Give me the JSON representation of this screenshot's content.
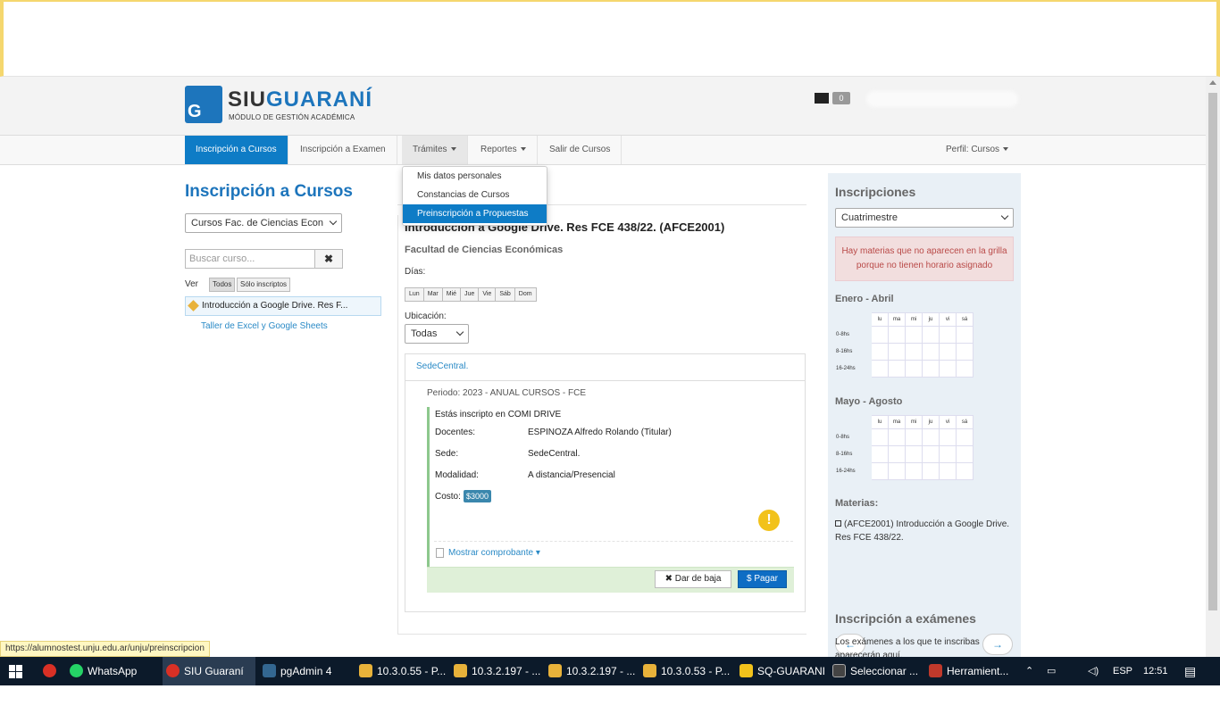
{
  "header": {
    "logo_main_a": "SIU",
    "logo_main_b": "GUARANÍ",
    "logo_sub": "MÓDULO DE GESTIÓN ACADÉMICA",
    "mail_count": "0"
  },
  "nav": {
    "items": [
      "Inscripción a Cursos",
      "Inscripción a Examen",
      "Trámites",
      "Reportes",
      "Salir de Cursos"
    ],
    "perfil": "Perfil: Cursos"
  },
  "dropdown": {
    "items": [
      "Mis datos personales",
      "Constancias de Cursos",
      "Preinscripción a Propuestas"
    ]
  },
  "left": {
    "title": "Inscripción a Cursos",
    "filter_select": "Cursos Fac. de Ciencias Econ",
    "search_placeholder": "Buscar curso...",
    "ver_label": "Ver",
    "btn_todos": "Todos",
    "btn_solo": "Sólo inscriptos",
    "courses": [
      "Introducción a Google Drive. Res F...",
      "Taller de Excel y Google Sheets"
    ]
  },
  "course": {
    "title": "Introducción a Google Drive. Res FCE 438/22. (AFCE2001)",
    "faculty": "Facultad de Ciencias Económicas",
    "dias_label": "Días:",
    "days": [
      "Lun",
      "Mar",
      "Mié",
      "Jue",
      "Vie",
      "Sáb",
      "Dom"
    ],
    "ubicacion_label": "Ubicación:",
    "ubicacion_value": "Todas",
    "sede_link": "SedeCentral.",
    "periodo": "Periodo: 2023 - ANUAL CURSOS - FCE",
    "inscripto": "Estás inscripto en COMI DRIVE",
    "docentes_label": "Docentes:",
    "docentes_value": "ESPINOZA Alfredo Rolando (Titular)",
    "sede_label": "Sede:",
    "sede_value": "SedeCentral.",
    "modalidad_label": "Modalidad:",
    "modalidad_value": "A distancia/Presencial",
    "costo_label": "Costo:",
    "costo_value": "$3000",
    "mostrar": "Mostrar comprobante ▾",
    "btn_baja": "✖ Dar de baja",
    "btn_pagar": "$ Pagar"
  },
  "side": {
    "title": "Inscripciones",
    "select": "Cuatrimestre",
    "alert": "Hay materias que no aparecen en la grilla porque no tienen horario asignado",
    "period1": "Enero - Abril",
    "period2": "Mayo - Agosto",
    "grid_days": [
      "lu",
      "ma",
      "mi",
      "ju",
      "vi",
      "sá"
    ],
    "grid_rows": [
      "0-8hs",
      "8-16hs",
      "16-24hs"
    ],
    "materias_label": "Materias:",
    "materia": "(AFCE2001) Introducción a Google Drive. Res FCE 438/22.",
    "prev": "←",
    "next": "→",
    "examenes_title": "Inscripción a exámenes",
    "examenes_text": "Los exámenes a los que te inscribas aparecerán aquí."
  },
  "status_url": "https://alumnostest.unju.edu.ar/unju/preinscripcion",
  "taskbar": {
    "apps": [
      "WhatsApp",
      "SIU Guaraní ...",
      "pgAdmin 4",
      "10.3.0.55 - P...",
      "10.3.2.197 - ...",
      "10.3.2.197 - ...",
      "10.3.0.53 - P...",
      "SQ-GUARANI",
      "Seleccionar ...",
      "Herramient..."
    ],
    "lang": "ESP",
    "time": "12:51"
  }
}
